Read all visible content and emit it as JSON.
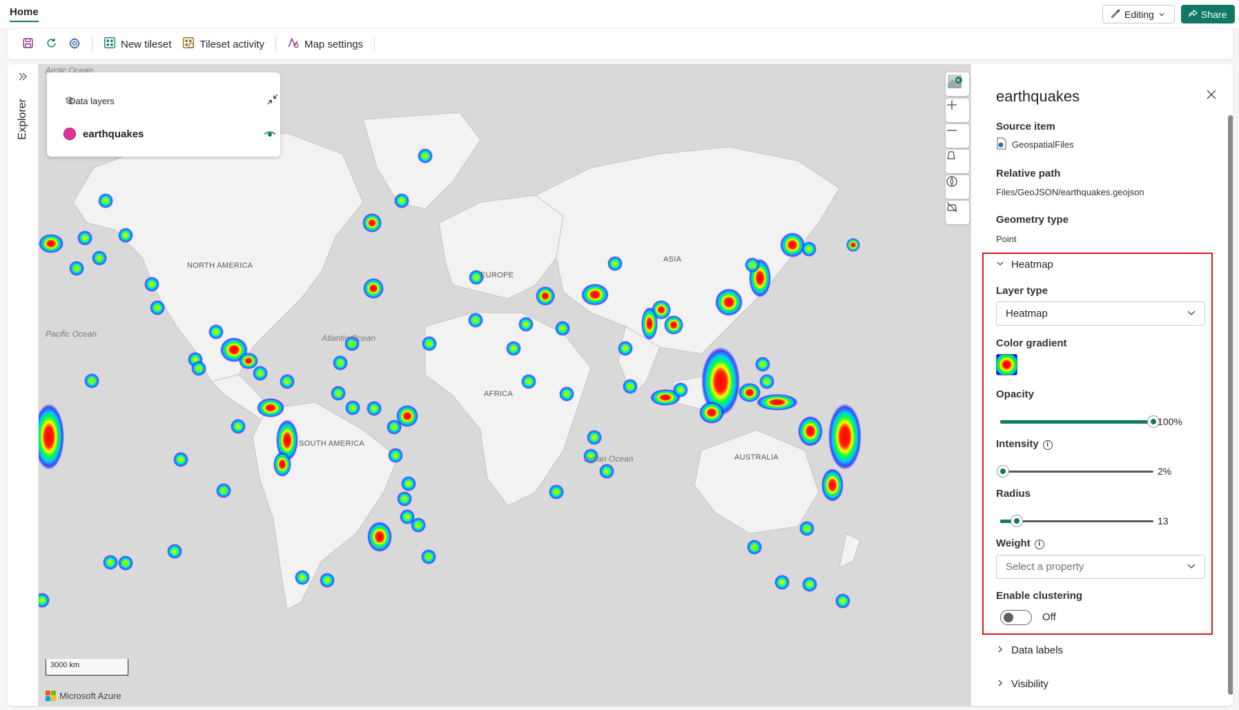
{
  "tabs": {
    "home": "Home"
  },
  "header": {
    "editing_label": "Editing",
    "share_label": "Share"
  },
  "toolbar": {
    "new_tileset_label": "New tileset",
    "tileset_activity_label": "Tileset activity",
    "map_settings_label": "Map settings"
  },
  "explorer": {
    "label": "Explorer"
  },
  "map": {
    "labels": [
      "Arctic Ocean",
      "NORTH AMERICA",
      "Pacific Ocean",
      "Atlantic Ocean",
      "EUROPE",
      "ASIA",
      "AFRICA",
      "SOUTH AMERICA",
      "Indian Ocean",
      "AUSTRALIA"
    ],
    "scale_label": "3000 km",
    "brand": "Microsoft Azure"
  },
  "data_layers": {
    "title": "Data layers",
    "layer_name": "earthquakes",
    "layer_color": "#e0349a"
  },
  "panel": {
    "title": "earthquakes",
    "source_item_label": "Source item",
    "source_item_value": "GeospatialFiles",
    "relative_path_label": "Relative path",
    "relative_path_value": "Files/GeoJSON/earthquakes.geojson",
    "geometry_type_label": "Geometry type",
    "geometry_type_value": "Point",
    "heatmap_section": "Heatmap",
    "layer_type_label": "Layer type",
    "layer_type_value": "Heatmap",
    "color_gradient_label": "Color gradient",
    "opacity_label": "Opacity",
    "opacity_value": "100%",
    "opacity_fraction": 1.0,
    "intensity_label": "Intensity",
    "intensity_value": "2%",
    "intensity_fraction": 0.02,
    "radius_label": "Radius",
    "radius_value": "13",
    "radius_fraction": 0.11,
    "weight_label": "Weight",
    "weight_placeholder": "Select a property",
    "clustering_label": "Enable clustering",
    "clustering_value": "Off",
    "data_labels_section": "Data labels",
    "visibility_section": "Visibility"
  },
  "colors": {
    "accent": "#117865",
    "highlight": "#d8191d"
  }
}
